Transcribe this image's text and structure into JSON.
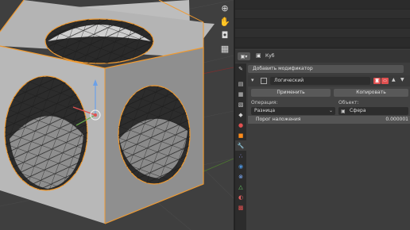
{
  "viewport": {
    "nav_icons": [
      "zoom-icon",
      "hand-pan-icon",
      "camera-icon",
      "grid-icon"
    ]
  },
  "properties": {
    "header": {
      "editor_icon": "▣▾",
      "object_name": "Куб"
    },
    "tabs": [
      {
        "name": "tool-tab-icon",
        "glyph": "✎",
        "color": "#d0d0d0"
      },
      {
        "name": "render-tab-icon",
        "glyph": "▤",
        "color": "#d0d0d0"
      },
      {
        "name": "output-tab-icon",
        "glyph": "▦",
        "color": "#d0d0d0"
      },
      {
        "name": "view-layer-tab-icon",
        "glyph": "▧",
        "color": "#d0d0d0"
      },
      {
        "name": "scene-tab-icon",
        "glyph": "◆",
        "color": "#d0d0d0"
      },
      {
        "name": "world-tab-icon",
        "glyph": "●",
        "color": "#e05050"
      },
      {
        "name": "object-tab-icon",
        "glyph": "■",
        "color": "#ff8c1a"
      },
      {
        "name": "modifier-tab-icon",
        "glyph": "🔧",
        "color": "#4a90d9"
      },
      {
        "name": "particles-tab-icon",
        "glyph": "∴",
        "color": "#9aa0ff"
      },
      {
        "name": "physics-tab-icon",
        "glyph": "◉",
        "color": "#4a90d9"
      },
      {
        "name": "constraints-tab-icon",
        "glyph": "⊗",
        "color": "#7fb0ff"
      },
      {
        "name": "data-tab-icon",
        "glyph": "△",
        "color": "#66cc66"
      },
      {
        "name": "material-tab-icon",
        "glyph": "◐",
        "color": "#e06060"
      },
      {
        "name": "texture-tab-icon",
        "glyph": "▩",
        "color": "#e05050"
      }
    ],
    "add_modifier": "Добавить модификатор",
    "modifier": {
      "name": "Логический",
      "apply": "Применить",
      "copy": "Копировать",
      "operation_label": "Операция:",
      "operation_value": "Разница",
      "object_label": "Объект:",
      "object_value": "Сфера",
      "overlap_label": "Порог наложения",
      "overlap_value": "0.000001"
    }
  }
}
